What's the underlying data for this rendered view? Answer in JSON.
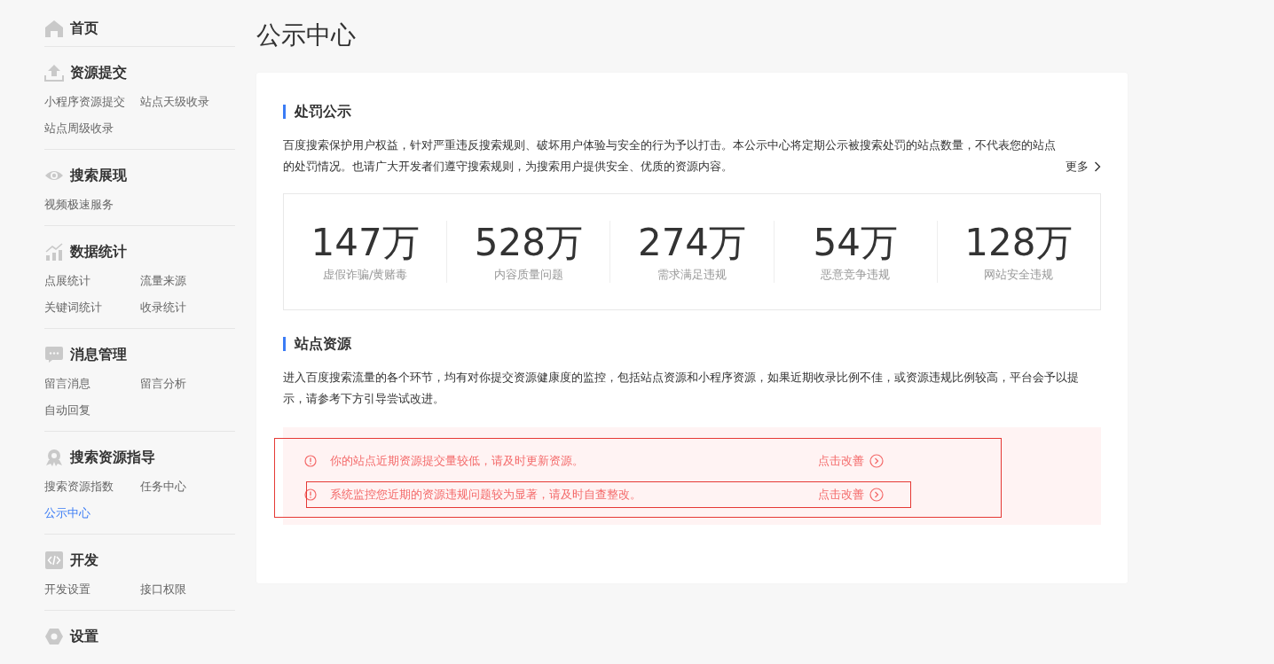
{
  "sidebar": {
    "sections": [
      {
        "title": "首页"
      },
      {
        "title": "资源提交",
        "items": [
          {
            "label": "小程序资源提交",
            "selected": false
          },
          {
            "label": "站点天级收录",
            "selected": false
          },
          {
            "label": "站点周级收录",
            "selected": false
          }
        ]
      },
      {
        "title": "搜索展现",
        "items": [
          {
            "label": "视频极速服务",
            "selected": false
          }
        ]
      },
      {
        "title": "数据统计",
        "items": [
          {
            "label": "点展统计",
            "selected": false
          },
          {
            "label": "流量来源",
            "selected": false
          },
          {
            "label": "关键词统计",
            "selected": false
          },
          {
            "label": "收录统计",
            "selected": false
          }
        ]
      },
      {
        "title": "消息管理",
        "items": [
          {
            "label": "留言消息",
            "selected": false
          },
          {
            "label": "留言分析",
            "selected": false
          },
          {
            "label": "自动回复",
            "selected": false
          }
        ]
      },
      {
        "title": "搜索资源指导",
        "items": [
          {
            "label": "搜索资源指数",
            "selected": false
          },
          {
            "label": "任务中心",
            "selected": false
          },
          {
            "label": "公示中心",
            "selected": true
          }
        ]
      },
      {
        "title": "开发",
        "items": [
          {
            "label": "开发设置",
            "selected": false
          },
          {
            "label": "接口权限",
            "selected": false
          }
        ]
      },
      {
        "title": "设置"
      }
    ]
  },
  "page_title": "公示中心",
  "penalty": {
    "heading": "处罚公示",
    "description": "百度搜索保护用户权益，针对严重违反搜索规则、破坏用户体验与安全的行为予以打击。本公示中心将定期公示被搜索处罚的站点数量，不代表您的站点的处罚情况。也请广大开发者们遵守搜索规则，为搜索用户提供安全、优质的资源内容。",
    "more": "更多",
    "stats": [
      {
        "value": "147万",
        "label": "虚假诈骗/黄赌毒"
      },
      {
        "value": "528万",
        "label": "内容质量问题"
      },
      {
        "value": "274万",
        "label": "需求满足违规"
      },
      {
        "value": "54万",
        "label": "恶意竞争违规"
      },
      {
        "value": "128万",
        "label": "网站安全违规"
      }
    ]
  },
  "resources": {
    "heading": "站点资源",
    "description": "进入百度搜索流量的各个环节，均有对你提交资源健康度的监控，包括站点资源和小程序资源，如果近期收录比例不佳，或资源违规比例较高，平台会予以提示，请参考下方引导尝试改进。",
    "alerts_highlighted": true,
    "alerts": [
      {
        "message": "你的站点近期资源提交量较低，请及时更新资源。",
        "action": "点击改善",
        "highlighted": false
      },
      {
        "message": "系统监控您近期的资源违规问题较为显著，请及时自查整改。",
        "action": "点击改善",
        "highlighted": true
      }
    ]
  }
}
